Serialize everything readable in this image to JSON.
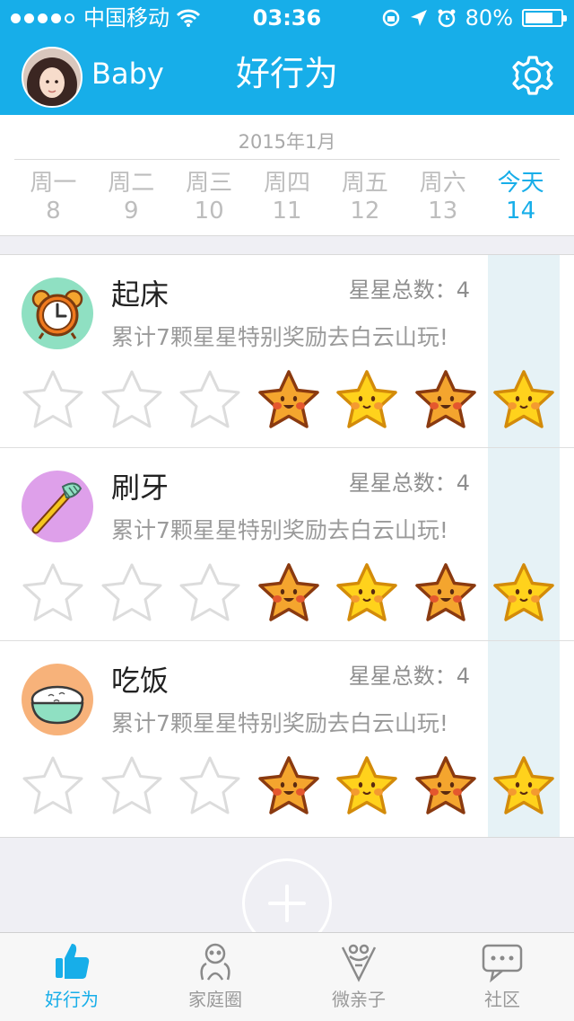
{
  "status_bar": {
    "carrier": "中国移动",
    "time": "03:36",
    "battery": "80%",
    "battery_level": 0.8
  },
  "header": {
    "user_name": "Baby",
    "title": "好行为"
  },
  "week": {
    "month": "2015年1月",
    "days": [
      {
        "name": "周一",
        "date": "8"
      },
      {
        "name": "周二",
        "date": "9"
      },
      {
        "name": "周三",
        "date": "10"
      },
      {
        "name": "周四",
        "date": "11"
      },
      {
        "name": "周五",
        "date": "12"
      },
      {
        "name": "周六",
        "date": "13"
      },
      {
        "name": "今天",
        "date": "14"
      }
    ]
  },
  "behaviors": [
    {
      "name": "起床",
      "count": "星星总数：4",
      "desc": "累计7颗星星特别奖励去白云山玩!",
      "icon": "alarm-clock-icon",
      "badge_color": "#8fe0c2",
      "stars": [
        "empty",
        "empty",
        "empty",
        "orange",
        "yellow",
        "orange",
        "yellow"
      ]
    },
    {
      "name": "刷牙",
      "count": "星星总数：4",
      "desc": "累计7颗星星特别奖励去白云山玩!",
      "icon": "toothbrush-icon",
      "badge_color": "#dea0ea",
      "stars": [
        "empty",
        "empty",
        "empty",
        "orange",
        "yellow",
        "orange",
        "yellow"
      ]
    },
    {
      "name": "吃饭",
      "count": "星星总数：4",
      "desc": "累计7颗星星特别奖励去白云山玩!",
      "icon": "rice-bowl-icon",
      "badge_color": "#f7b27a",
      "stars": [
        "empty",
        "empty",
        "empty",
        "orange",
        "yellow",
        "orange",
        "yellow"
      ]
    }
  ],
  "tabs": [
    {
      "label": "好行为",
      "icon": "thumbs-up-icon",
      "active": true
    },
    {
      "label": "家庭圈",
      "icon": "family-circle-icon",
      "active": false
    },
    {
      "label": "微亲子",
      "icon": "parent-child-icon",
      "active": false
    },
    {
      "label": "社区",
      "icon": "chat-bubble-icon",
      "active": false
    }
  ],
  "colors": {
    "brand": "#17aee9",
    "star_orange": "#f4a52e",
    "star_yellow": "#ffd21c",
    "star_outline": "#8a3a10",
    "today_column": "#e6f2f6"
  }
}
